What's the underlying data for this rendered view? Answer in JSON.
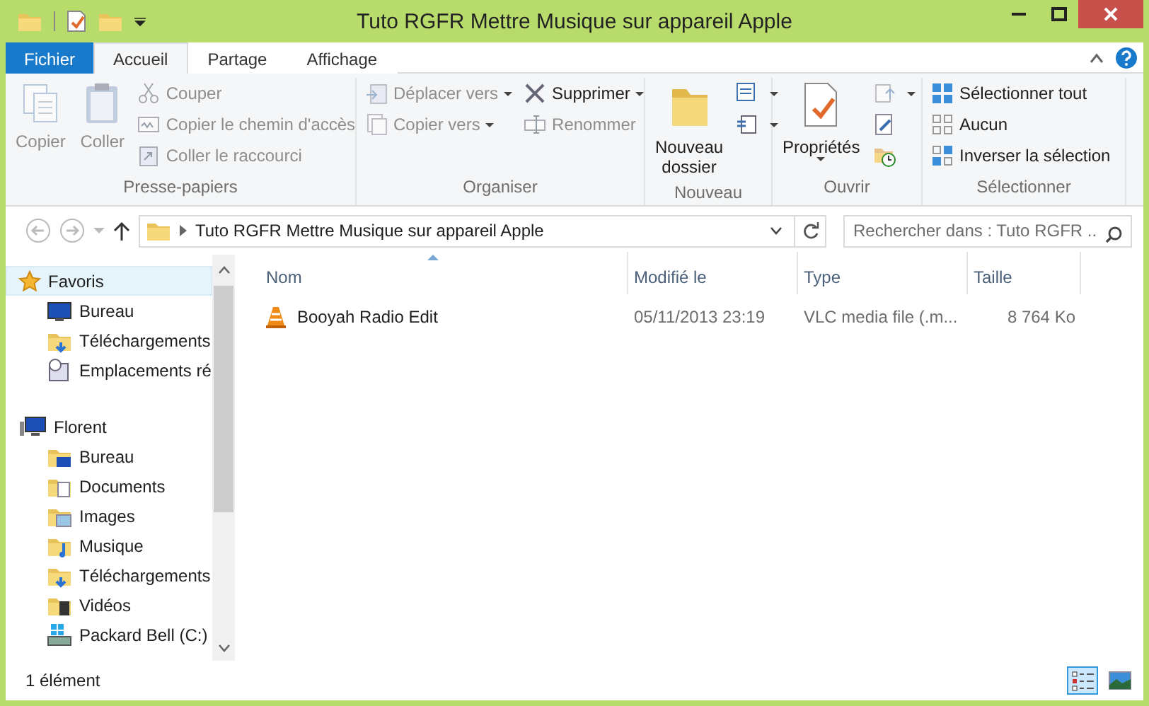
{
  "window": {
    "title": "Tuto RGFR Mettre Musique sur appareil Apple"
  },
  "ribbon_tabs": [
    {
      "label": "Fichier",
      "kind": "file",
      "selected": false
    },
    {
      "label": "Accueil",
      "kind": "tab",
      "selected": true
    },
    {
      "label": "Partage",
      "kind": "tab",
      "selected": false
    },
    {
      "label": "Affichage",
      "kind": "tab",
      "selected": false
    }
  ],
  "ribbon_groups": [
    {
      "label": "Presse-papiers",
      "columns": [
        {
          "kind": "large",
          "label": "Copier",
          "disabled": true
        },
        {
          "kind": "large",
          "label": "Coller",
          "disabled": true
        },
        {
          "kind": "stack",
          "items": [
            {
              "label": "Couper",
              "disabled": true
            },
            {
              "label": "Copier le chemin d'accès",
              "disabled": true
            },
            {
              "label": "Coller le raccourci",
              "disabled": true
            }
          ]
        }
      ]
    },
    {
      "label": "Organiser",
      "columns": [
        {
          "kind": "stack",
          "items": [
            {
              "label": "Déplacer vers",
              "disabled": true,
              "dropdown": true
            },
            {
              "label": "Copier vers",
              "disabled": true,
              "dropdown": true
            }
          ]
        },
        {
          "kind": "stack",
          "items": [
            {
              "label": "Supprimer",
              "disabled": false,
              "dropdown": true
            },
            {
              "label": "Renommer",
              "disabled": true
            }
          ]
        }
      ]
    },
    {
      "label": "Nouveau",
      "columns": [
        {
          "kind": "large",
          "label": "Nouveau dossier",
          "disabled": false
        },
        {
          "kind": "stack",
          "items": [
            {
              "disabled": false,
              "dropdown": true
            },
            {
              "disabled": false,
              "dropdown": true
            }
          ]
        }
      ]
    },
    {
      "label": "Ouvrir",
      "columns": [
        {
          "kind": "large",
          "label": "Propriétés",
          "disabled": false,
          "dropdown": true
        },
        {
          "kind": "stack",
          "items": [
            {
              "disabled": true,
              "dropdown": true
            },
            {
              "disabled": false
            },
            {
              "disabled": false
            }
          ]
        }
      ]
    },
    {
      "label": "Sélectionner",
      "columns": [
        {
          "kind": "stack",
          "items": [
            {
              "label": "Sélectionner tout",
              "disabled": false
            },
            {
              "label": "Aucun",
              "disabled": false
            },
            {
              "label": "Inverser la sélection",
              "disabled": false
            }
          ]
        }
      ]
    }
  ],
  "address_bar": {
    "path": "Tuto RGFR Mettre Musique sur appareil Apple"
  },
  "search": {
    "placeholder": "Rechercher dans : Tuto RGFR ..."
  },
  "navigation_pane": [
    {
      "label": "Favoris",
      "selected": true,
      "children": [
        {
          "label": "Bureau",
          "selected": false
        },
        {
          "label": "Téléchargements",
          "selected": false
        },
        {
          "label": "Emplacements ré",
          "selected": false
        }
      ]
    },
    {
      "label": "Florent",
      "selected": false,
      "children": [
        {
          "label": "Bureau",
          "selected": false
        },
        {
          "label": "Documents",
          "selected": false
        },
        {
          "label": "Images",
          "selected": false
        },
        {
          "label": "Musique",
          "selected": false
        },
        {
          "label": "Téléchargements",
          "selected": false
        },
        {
          "label": "Vidéos",
          "selected": false
        },
        {
          "label": "Packard Bell (C:)",
          "selected": false
        }
      ]
    }
  ],
  "file_list": {
    "columns": [
      {
        "label": "Nom",
        "sorted": true
      },
      {
        "label": "Modifié le",
        "sorted": false
      },
      {
        "label": "Type",
        "sorted": false
      },
      {
        "label": "Taille",
        "sorted": false
      }
    ],
    "rows": [
      {
        "name": "Booyah Radio Edit",
        "modified": "05/11/2013 23:19",
        "type": "VLC media file (.m...",
        "size": "8 764 Ko"
      }
    ]
  },
  "status_bar": {
    "count": "1 élément",
    "views": [
      {
        "kind": "details",
        "selected": true
      },
      {
        "kind": "large_icons",
        "selected": false
      }
    ]
  }
}
